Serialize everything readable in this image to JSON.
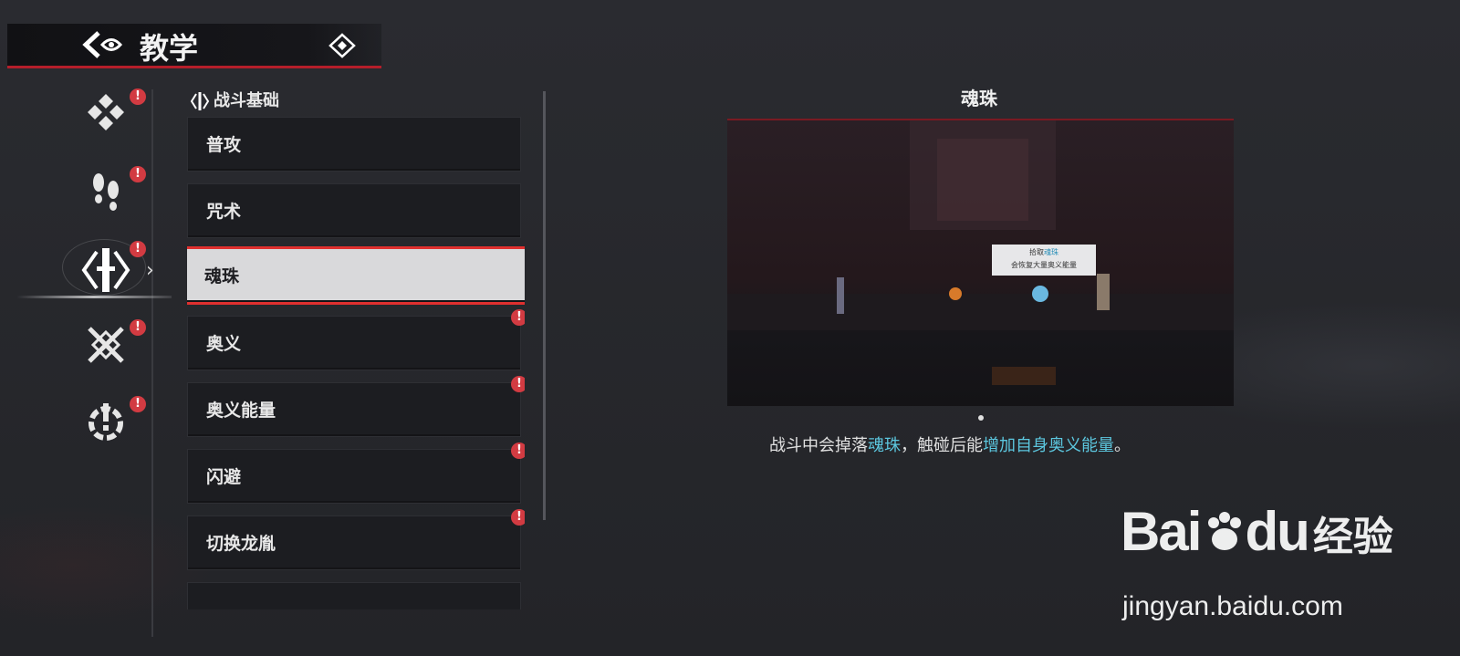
{
  "header": {
    "title": "教学"
  },
  "sidebar": {
    "categories": [
      {
        "icon": "diamond-cluster-icon",
        "badge": "!"
      },
      {
        "icon": "footprints-icon",
        "badge": "!"
      },
      {
        "icon": "combat-sword-icon",
        "badge": "!",
        "active": true
      },
      {
        "icon": "crossed-blades-icon",
        "badge": "!"
      },
      {
        "icon": "gear-alert-icon",
        "badge": "!"
      }
    ]
  },
  "section": {
    "title": "战斗基础"
  },
  "list": {
    "items": [
      {
        "label": "普攻",
        "badge": ""
      },
      {
        "label": "咒术",
        "badge": ""
      },
      {
        "label": "魂珠",
        "badge": "",
        "selected": true
      },
      {
        "label": "奥义",
        "badge": "!"
      },
      {
        "label": "奥义能量",
        "badge": "!"
      },
      {
        "label": "闪避",
        "badge": "!"
      },
      {
        "label": "切换龙胤",
        "badge": "!"
      },
      {
        "label": "",
        "badge": ""
      }
    ]
  },
  "detail": {
    "title": "魂珠",
    "tip_line1_prefix": "拾取",
    "tip_line1_highlight": "魂珠",
    "tip_line2": "会恢复大量奥义能量",
    "desc_part1": "战斗中会掉落",
    "desc_hl1": "魂珠",
    "desc_part2": "，触碰后能",
    "desc_hl2": "增加自身奥义能量",
    "desc_part3": "。"
  },
  "watermark": {
    "brand": "Bai",
    "brand2": "du",
    "cn": "经验",
    "url": "jingyan.baidu.com"
  },
  "colors": {
    "accent_red": "#d23b42",
    "highlight_cyan": "#5cc7df",
    "selected_bg": "#d9d9db"
  }
}
